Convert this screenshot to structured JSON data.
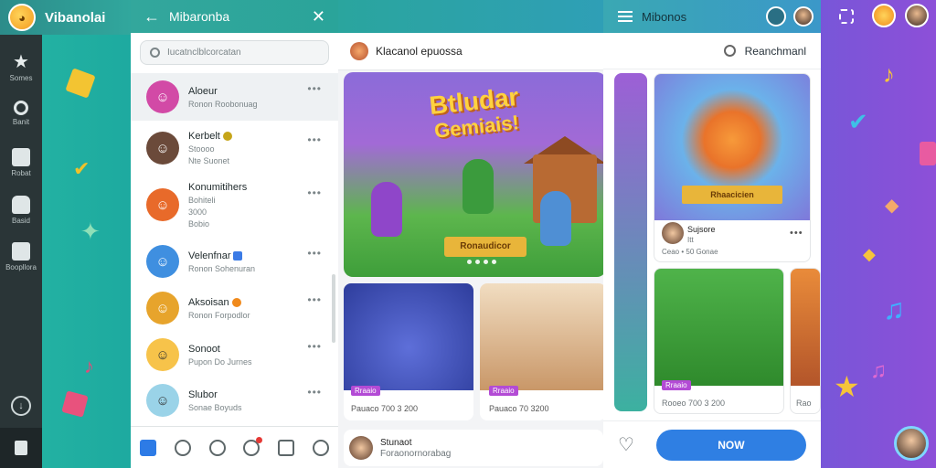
{
  "app": {
    "title": "Vibanolai",
    "logo_glyph": "◕"
  },
  "rail": {
    "items": [
      {
        "label": "Somes",
        "icon": "star-icon"
      },
      {
        "label": "Banit",
        "icon": "search-icon"
      },
      {
        "label": "Robat",
        "icon": "note-icon"
      },
      {
        "label": "Basid",
        "icon": "bag-icon"
      },
      {
        "label": "Boopllora",
        "icon": "list-icon"
      }
    ]
  },
  "chat": {
    "title": "Mibaronba",
    "back_glyph": "←",
    "close_glyph": "✕",
    "search_placeholder": "Iucatnclblcorcatan",
    "contacts": [
      {
        "name": "Aloeur",
        "sub": "Ronon Roobonuag",
        "color": "#d24aa6"
      },
      {
        "name": "Kerbelt",
        "sub2": "Stoooo",
        "sub": "Nte Suonet",
        "color": "#6b4a3a",
        "badge": "#c6a519"
      },
      {
        "name": "Konumitihers",
        "name2": "Bohiteli",
        "sub2": "3000",
        "sub": "Bobio",
        "color": "#e86a2a"
      },
      {
        "name": "Velenfnar",
        "sub": "Ronon Sohenuran",
        "color": "#3f8fe0",
        "badge": "#3b7be6"
      },
      {
        "name": "Aksoisan",
        "sub": "Ronon Forpodlor",
        "color": "#e7a42c",
        "badge": "#f08a1c"
      },
      {
        "name": "Sonoot",
        "sub": "Pupon Do Jurnes",
        "color": "#f7c34a"
      },
      {
        "name": "Slubor",
        "sub": "Sonae Boyuds",
        "color": "#9ad3e8"
      }
    ],
    "more_glyph": "•••"
  },
  "feed": {
    "header_title": "Klacanol epuossa",
    "hero": {
      "title_line1": "Btludar",
      "title_line2": "Gemiais!",
      "ribbon": "Ronaudicor"
    },
    "cards": [
      {
        "tag": "Rraaio",
        "meta": "Pauaco 700 3 200"
      },
      {
        "tag": "Rraaio",
        "meta": "Pauaco 70 3200"
      }
    ],
    "footer": {
      "name": "Stunaot",
      "sub": "Foraonornorabag"
    }
  },
  "right": {
    "title": "Mibonos",
    "search_text": "Reanchmanl",
    "card1": {
      "ribbon": "Rhaacicien",
      "name": "Sujsore",
      "sub1": "Itt",
      "sub2": "Ceao • 50 Gonae"
    },
    "card2": {
      "tag": "Rraaio",
      "meta": "Rooeo 700 3 200"
    },
    "card3": {
      "meta": "Rao"
    },
    "more_glyph": "•••",
    "heart_glyph": "♡",
    "button_label": "NOW"
  },
  "colors": {
    "accent": "#2f7fe3",
    "teal": "#2aa49a",
    "rail": "#2a3537"
  }
}
